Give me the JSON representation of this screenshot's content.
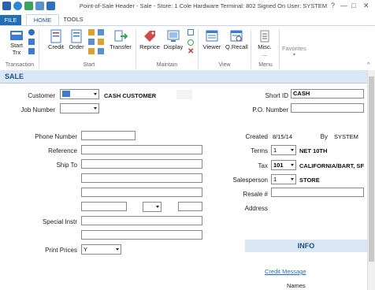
{
  "window": {
    "title": "Point-of-Sale Header - Sale - Store: 1 Cole Hardware Terminal: 802 Signed On User: SYSTEM",
    "controls": [
      "?",
      "—",
      "□",
      "✕"
    ]
  },
  "tabs": [
    {
      "label": "FILE"
    },
    {
      "label": "HOME"
    },
    {
      "label": "TOOLS"
    }
  ],
  "ribbon": {
    "transaction": {
      "start_trx": "Start\nTrx",
      "group": "Transaction"
    },
    "start": {
      "credit": "Credit",
      "order": "Order",
      "transfer": "Transfer",
      "group": "Start"
    },
    "maintain": {
      "reprice": "Reprice",
      "display": "Display",
      "group": "Maintain"
    },
    "view": {
      "viewer": "Viewer",
      "qrecall": "Q.Recall",
      "group": "View"
    },
    "menu": {
      "misc": "Misc.\n...",
      "group": "Menu"
    },
    "favorites": {
      "label": "Favorites"
    }
  },
  "sale": {
    "title": "SALE",
    "customer_label": "Customer",
    "customer_name": "CASH CUSTOMER",
    "job_number_label": "Job Number",
    "short_id_label": "Short ID",
    "short_id_value": "CASH",
    "po_number_label": "P.O. Number",
    "phone_label": "Phone Number",
    "reference_label": "Reference",
    "ship_to_label": "Ship To",
    "special_instr_label": "Special Instr",
    "print_prices_label": "Print Prices",
    "print_prices_value": "Y",
    "created_label": "Created",
    "created_value": "8/15/14",
    "by_label": "By",
    "by_value": "SYSTEM",
    "terms_label": "Terms",
    "terms_code": "1",
    "terms_value": "NET 10TH",
    "tax_label": "Tax",
    "tax_code": "101",
    "tax_value": "CALIFORNIA/BART, SF",
    "salesperson_label": "Salesperson",
    "salesperson_code": "1",
    "salesperson_value": "STORE",
    "resale_label": "Resale #",
    "address_label": "Address"
  },
  "info": {
    "title": "INFO",
    "credit_message": "Credit Message",
    "names": "Names"
  },
  "colors": {
    "accent": "#1f6fb7",
    "header_bg": "#dbe7f5"
  }
}
